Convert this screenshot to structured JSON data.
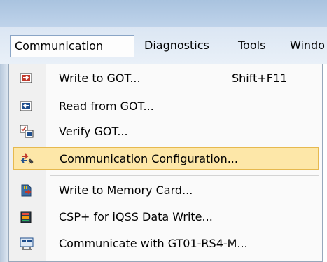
{
  "menubar": {
    "menus": [
      {
        "label": "Communication",
        "active": true
      },
      {
        "label": "Diagnostics",
        "active": false
      },
      {
        "label": "Tools",
        "active": false
      },
      {
        "label": "Windo",
        "active": false
      }
    ]
  },
  "dropdown": {
    "items": [
      {
        "label": "Write to GOT...",
        "shortcut": "Shift+F11",
        "icon": "write-to-got-icon",
        "highlighted": false
      },
      {
        "label": "Read from GOT...",
        "shortcut": "",
        "icon": "read-from-got-icon",
        "highlighted": false
      },
      {
        "label": "Verify GOT...",
        "shortcut": "",
        "icon": "verify-got-icon",
        "highlighted": false
      },
      {
        "label": "Communication Configuration...",
        "shortcut": "",
        "icon": "communication-configuration-icon",
        "highlighted": true
      },
      {
        "label": "Write to Memory Card...",
        "shortcut": "",
        "icon": "memory-card-icon",
        "highlighted": false
      },
      {
        "label": "CSP+ for iQSS Data Write...",
        "shortcut": "",
        "icon": "csp-data-write-icon",
        "highlighted": false
      },
      {
        "label": "Communicate with GT01-RS4-M...",
        "shortcut": "",
        "icon": "gt01-rs4-m-icon",
        "highlighted": false
      }
    ]
  },
  "colors": {
    "highlight_fill": "#fde7a8",
    "highlight_border": "#e6b94f",
    "write_icon": "#c0392b",
    "read_icon": "#1f4e8c"
  }
}
